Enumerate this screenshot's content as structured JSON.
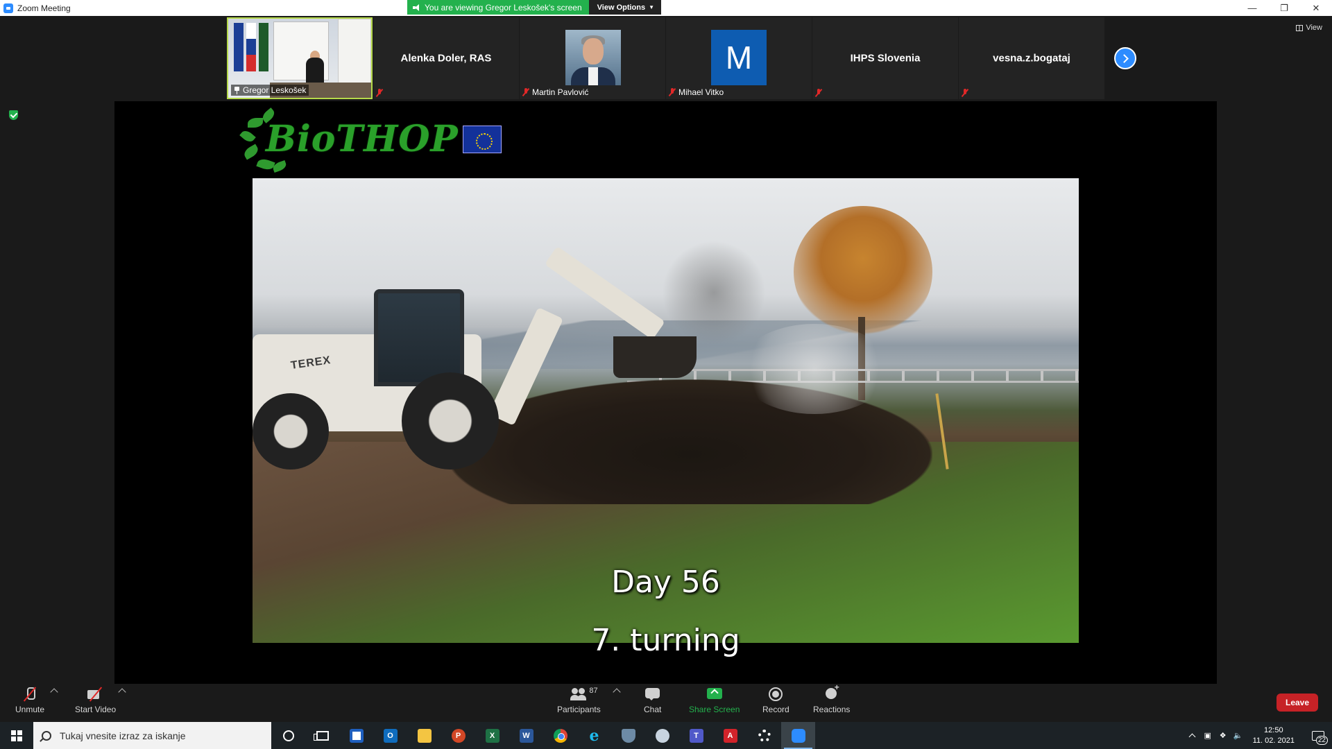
{
  "window": {
    "title": "Zoom Meeting"
  },
  "banner": {
    "viewing_text": "You are viewing Gregor Leskošek's screen",
    "view_options_label": "View Options"
  },
  "view_button_label": "View",
  "participants_strip": {
    "tiles": [
      {
        "name": "Gregor Leskošek",
        "type": "video",
        "pinned": true
      },
      {
        "name": "Alenka Doler, RAS",
        "type": "name-only"
      },
      {
        "name": "Martin Pavlović",
        "type": "photo"
      },
      {
        "name": "Mihael Vitko",
        "type": "letter",
        "letter": "M"
      },
      {
        "name": "IHPS Slovenia",
        "type": "name-only"
      },
      {
        "name": "vesna.z.bogataj",
        "type": "name-only"
      }
    ]
  },
  "shared_screen": {
    "logo_text": "BioTHOP",
    "photo_label": "TEREX",
    "caption_day": "Day 56",
    "caption_step": "7. turning"
  },
  "toolbar": {
    "unmute_label": "Unmute",
    "start_video_label": "Start Video",
    "participants_label": "Participants",
    "participants_count": "87",
    "chat_label": "Chat",
    "share_screen_label": "Share Screen",
    "record_label": "Record",
    "reactions_label": "Reactions",
    "leave_label": "Leave"
  },
  "taskbar": {
    "search_placeholder": "Tukaj vnesite izraz za iskanje",
    "time": "12:50",
    "date": "11. 02. 2021",
    "notification_count": "22"
  },
  "colors": {
    "zoom_blue": "#2d8cff",
    "share_green": "#23b14d",
    "leave_red": "#c62226",
    "muted_red": "#e02828"
  }
}
